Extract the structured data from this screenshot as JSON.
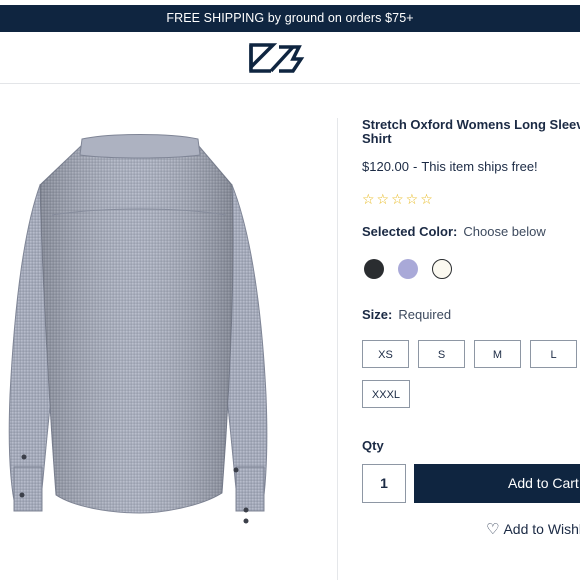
{
  "banner": {
    "text": "FREE SHIPPING by ground on orders $75+"
  },
  "brand": {
    "logo_name": "cutter-buck-logo"
  },
  "product": {
    "title": "Stretch Oxford Womens Long Sleeve Shirt",
    "price": "$120.00",
    "separator": "-",
    "shipping_note": "This item ships free!",
    "rating_stars": "☆☆☆☆☆",
    "image_name": "product-image-shirt-back"
  },
  "color": {
    "label": "Selected Color:",
    "value": "Choose below",
    "swatches": [
      "#2a2d30",
      "#a9a9d8",
      "#fbf9f0"
    ]
  },
  "size": {
    "label": "Size:",
    "required": "Required",
    "options": [
      "XS",
      "S",
      "M",
      "L",
      "XXXL"
    ]
  },
  "qty": {
    "label": "Qty",
    "value": "1"
  },
  "actions": {
    "add_to_cart": "Add to Cart",
    "wishlist": "Add to Wishlist",
    "wishlist_icon": "heart-icon"
  }
}
